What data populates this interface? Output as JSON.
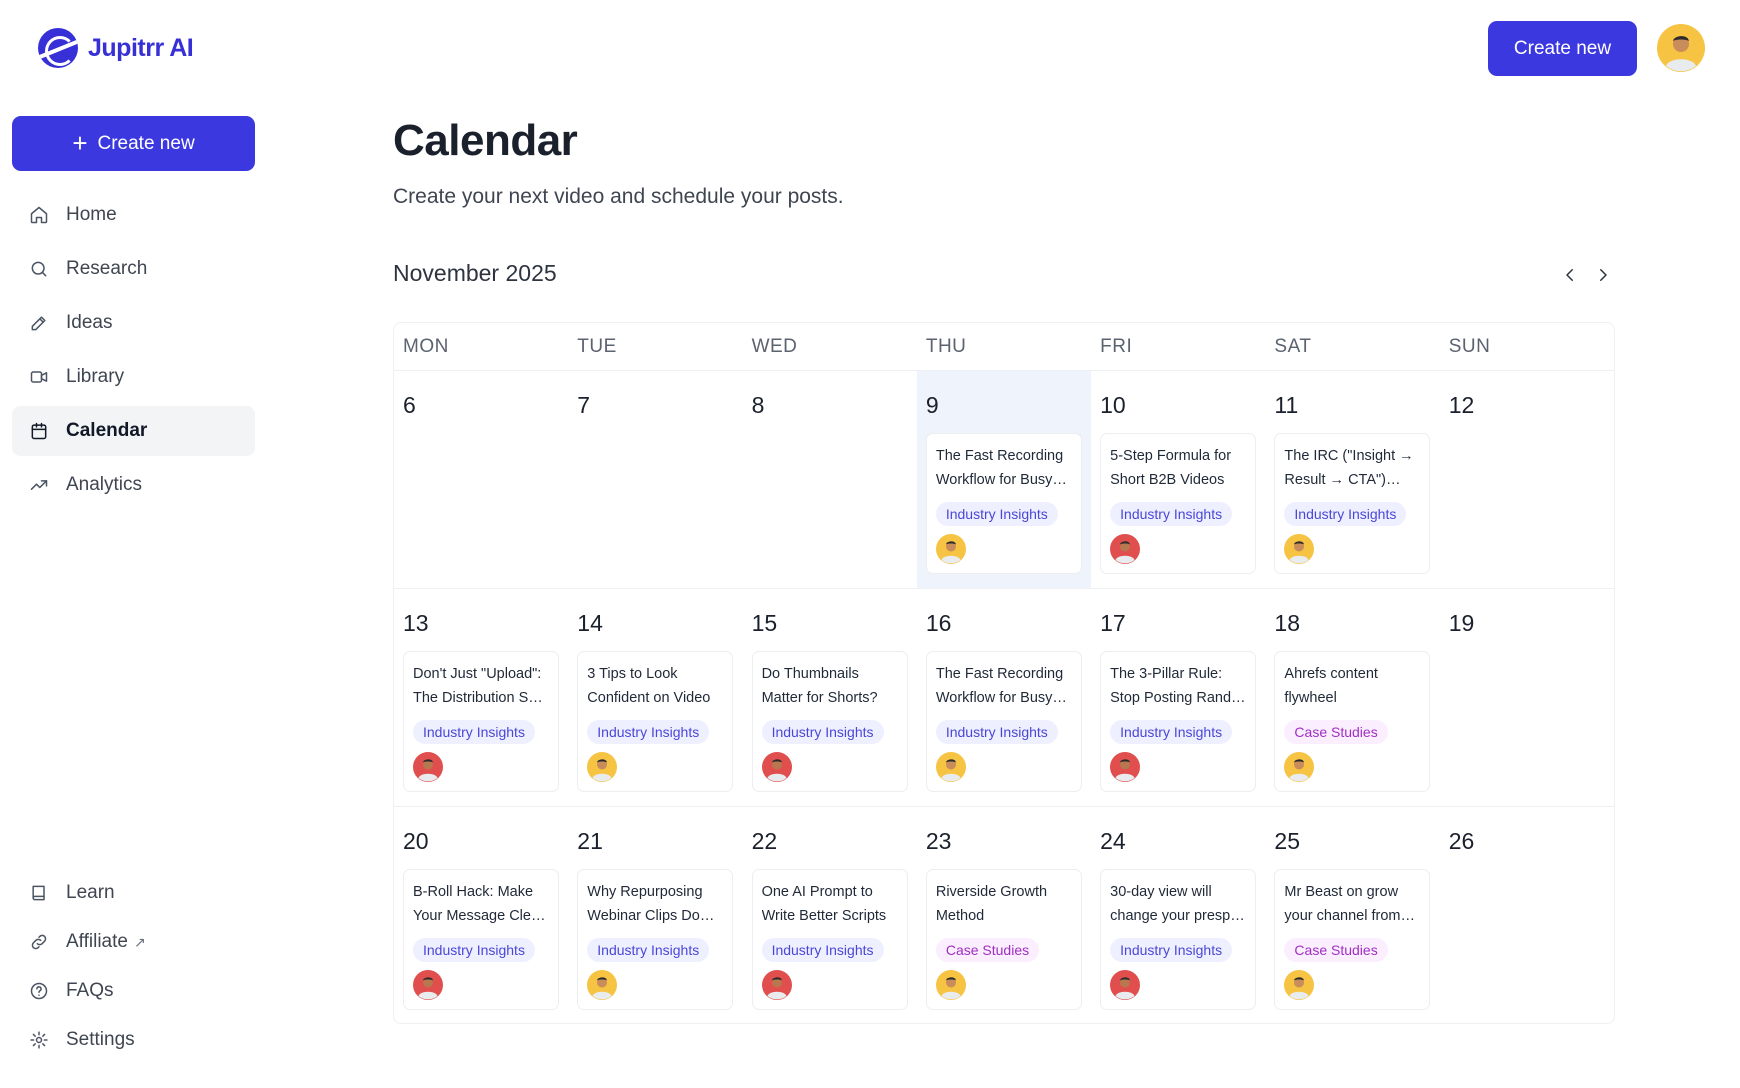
{
  "app": {
    "brand": "Jupitrr AI"
  },
  "sidebar": {
    "create_label": "Create new",
    "items": [
      {
        "label": "Home",
        "icon": "home-icon"
      },
      {
        "label": "Research",
        "icon": "search-icon"
      },
      {
        "label": "Ideas",
        "icon": "pencil-icon"
      },
      {
        "label": "Library",
        "icon": "video-camera-icon"
      },
      {
        "label": "Calendar",
        "icon": "calendar-icon",
        "active": true
      },
      {
        "label": "Analytics",
        "icon": "trending-up-icon"
      }
    ],
    "bottom_items": [
      {
        "label": "Learn",
        "icon": "book-icon"
      },
      {
        "label": "Affiliate",
        "icon": "link-icon",
        "external": true
      },
      {
        "label": "FAQs",
        "icon": "help-circle-icon"
      },
      {
        "label": "Settings",
        "icon": "gear-icon"
      }
    ]
  },
  "topbar": {
    "create_label": "Create new"
  },
  "header": {
    "title": "Calendar",
    "subtitle": "Create your next video and schedule your posts."
  },
  "calendar": {
    "month": "November 2025",
    "weekdays": [
      "MON",
      "TUE",
      "WED",
      "THU",
      "FRI",
      "SAT",
      "SUN"
    ],
    "weeks": [
      {
        "days": [
          {
            "num": "6",
            "post": null
          },
          {
            "num": "7",
            "post": null
          },
          {
            "num": "8",
            "post": null
          },
          {
            "num": "9",
            "today": true,
            "post": {
              "title": "The Fast Recording Workflow for Busy…",
              "tag": "Industry Insights",
              "tag_type": "ii",
              "avatar": "yellow"
            }
          },
          {
            "num": "10",
            "post": {
              "title": "5-Step Formula for Short B2B Videos",
              "tag": "Industry Insights",
              "tag_type": "ii",
              "avatar": "red"
            }
          },
          {
            "num": "11",
            "post": {
              "title": "The IRC (\"Insight → Result → CTA\") Sc…",
              "tag": "Industry Insights",
              "tag_type": "ii",
              "avatar": "yellow"
            }
          },
          {
            "num": "12",
            "post": null
          }
        ]
      },
      {
        "days": [
          {
            "num": "13",
            "post": {
              "title": "Don't Just \"Upload\": The Distribution S…",
              "tag": "Industry Insights",
              "tag_type": "ii",
              "avatar": "red"
            }
          },
          {
            "num": "14",
            "post": {
              "title": "3 Tips to Look Confident on Video",
              "tag": "Industry Insights",
              "tag_type": "ii",
              "avatar": "yellow"
            }
          },
          {
            "num": "15",
            "post": {
              "title": "Do Thumbnails Matter for Shorts?",
              "tag": "Industry Insights",
              "tag_type": "ii",
              "avatar": "red"
            }
          },
          {
            "num": "16",
            "post": {
              "title": "The Fast Recording Workflow for Busy…",
              "tag": "Industry Insights",
              "tag_type": "ii",
              "avatar": "yellow"
            }
          },
          {
            "num": "17",
            "post": {
              "title": "The 3-Pillar Rule: Stop Posting Rand…",
              "tag": "Industry Insights",
              "tag_type": "ii",
              "avatar": "red"
            }
          },
          {
            "num": "18",
            "post": {
              "title": "Ahrefs content flywheel",
              "tag": "Case Studies",
              "tag_type": "cs",
              "avatar": "yellow"
            }
          },
          {
            "num": "19",
            "post": null
          }
        ]
      },
      {
        "days": [
          {
            "num": "20",
            "post": {
              "title": "B-Roll Hack: Make Your Message Cle…",
              "tag": "Industry Insights",
              "tag_type": "ii",
              "avatar": "red"
            }
          },
          {
            "num": "21",
            "post": {
              "title": "Why Repurposing Webinar Clips Do…",
              "tag": "Industry Insights",
              "tag_type": "ii",
              "avatar": "yellow"
            }
          },
          {
            "num": "22",
            "post": {
              "title": "One AI Prompt to Write Better Scripts",
              "tag": "Industry Insights",
              "tag_type": "ii",
              "avatar": "red"
            }
          },
          {
            "num": "23",
            "post": {
              "title": "Riverside Growth Method",
              "tag": "Case Studies",
              "tag_type": "cs",
              "avatar": "yellow"
            }
          },
          {
            "num": "24",
            "post": {
              "title": "30-day view will change your presp…",
              "tag": "Industry Insights",
              "tag_type": "ii",
              "avatar": "red"
            }
          },
          {
            "num": "25",
            "post": {
              "title": "Mr Beast on grow your channel from…",
              "tag": "Case Studies",
              "tag_type": "cs",
              "avatar": "yellow"
            }
          },
          {
            "num": "26",
            "post": null
          }
        ]
      }
    ]
  },
  "colors": {
    "accent": "#3c38e0",
    "brand": "#3730d6",
    "today_bg": "#eef3fc",
    "tag_insights_bg": "#eef0ff",
    "tag_insights_fg": "#4a47d6",
    "tag_case_bg": "#fbeefe",
    "tag_case_fg": "#a12fc4",
    "avatar_yellow": "#f6c343",
    "avatar_red": "#e04e4e"
  }
}
